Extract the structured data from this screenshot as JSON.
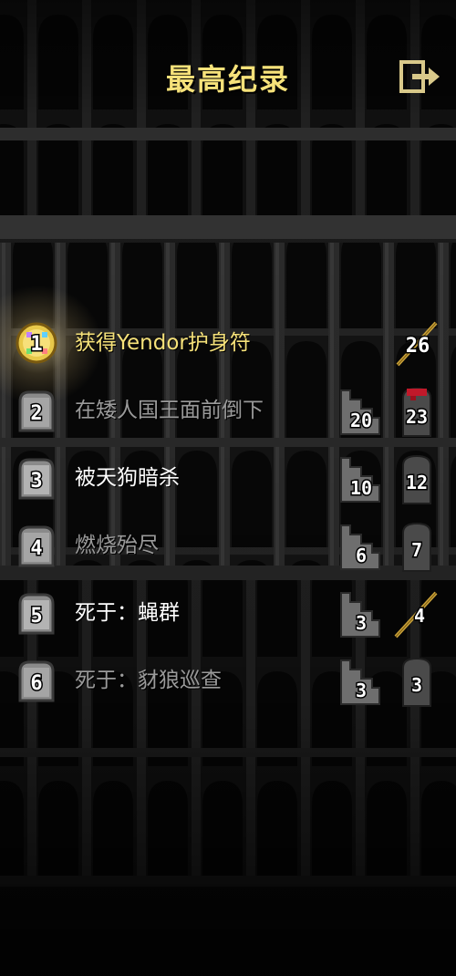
{
  "header": {
    "title": "最高纪录"
  },
  "colors": {
    "title": "#f6e27a",
    "winner_text": "#f6e27a",
    "bright_text": "#ffffff",
    "dim_text": "#9a9a9a",
    "background": "#0c0c0c"
  },
  "records": [
    {
      "rank": "1",
      "description": "获得Yendor护身符",
      "depth": "",
      "level": "26",
      "style": "win",
      "rank_icon": "amulet-of-yendor-icon",
      "level_icon": "staff-icon"
    },
    {
      "rank": "2",
      "description": "在矮人国王面前倒下",
      "depth": "20",
      "level": "23",
      "style": "dim",
      "rank_icon": "tombstone-icon",
      "level_icon": "bloody-gravestone-icon"
    },
    {
      "rank": "3",
      "description": "被天狗暗杀",
      "depth": "10",
      "level": "12",
      "style": "bright",
      "rank_icon": "tombstone-icon",
      "level_icon": "gravestone-icon"
    },
    {
      "rank": "4",
      "description": "燃烧殆尽",
      "depth": "6",
      "level": "7",
      "style": "dim",
      "rank_icon": "tombstone-icon",
      "level_icon": "gravestone-icon"
    },
    {
      "rank": "5",
      "description": "死于：蝇群",
      "depth": "3",
      "level": "4",
      "style": "bright",
      "rank_icon": "tombstone-icon",
      "level_icon": "staff-icon"
    },
    {
      "rank": "6",
      "description": "死于：豺狼巡查",
      "depth": "3",
      "level": "3",
      "style": "dim",
      "rank_icon": "tombstone-icon",
      "level_icon": "gravestone-icon"
    }
  ]
}
